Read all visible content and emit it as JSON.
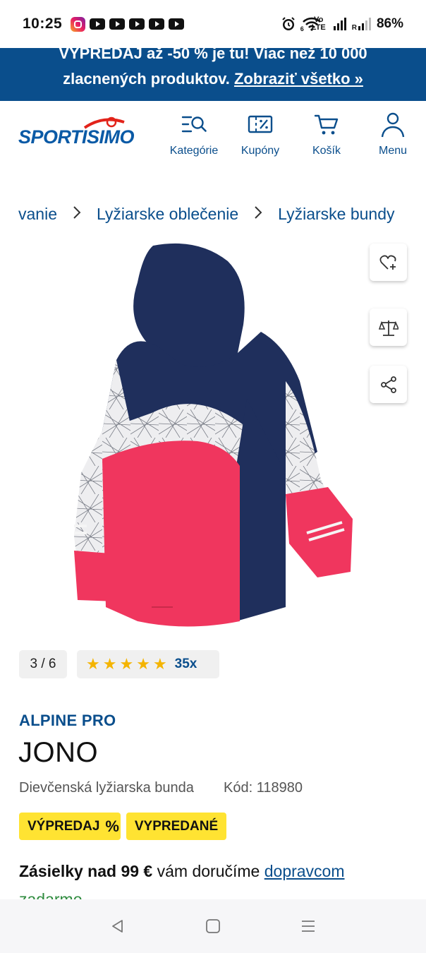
{
  "status": {
    "time": "10:25",
    "battery": "86%",
    "volte": "Vo LTE",
    "net": "6",
    "roaming": "R",
    "apps": [
      "instagram-icon",
      "youtube-icon",
      "youtube-icon",
      "youtube-icon",
      "youtube-icon",
      "youtube-icon"
    ]
  },
  "promo": {
    "line1": "VÝPREDAJ až -50 % je tu! Viac než 10 000",
    "line2_text": "zlacnených produktov.",
    "link": "Zobraziť všetko »"
  },
  "header": {
    "logo": "SPORTISIMO",
    "nav": [
      {
        "label": "Kategórie",
        "icon": "categories-search-icon"
      },
      {
        "label": "Kupóny",
        "icon": "coupon-icon"
      },
      {
        "label": "Košík",
        "icon": "cart-icon"
      },
      {
        "label": "Menu",
        "icon": "user-icon"
      }
    ]
  },
  "breadcrumb": {
    "items": [
      "vanie",
      "Lyžiarske oblečenie",
      "Lyžiarske bundy"
    ]
  },
  "gallery": {
    "counter": "3 / 6",
    "rating_stars": 5,
    "rating_count": "35x",
    "image_alt": "Dievčenská lyžiarska bunda ALPINE PRO JONO - zadný pohľad"
  },
  "product": {
    "brand": "ALPINE PRO",
    "name": "JONO",
    "description": "Dievčenská lyžiarska bunda",
    "code": "Kód: 118980",
    "badges": {
      "sale": "VÝPREDAJ",
      "sale_symbol": "%",
      "sold_out": "VYPREDANÉ"
    },
    "shipping": {
      "bold": "Zásielky nad 99 €",
      "text": " vám doručíme ",
      "link": "dopravcom",
      "link2": "zadarmo"
    }
  },
  "colors": {
    "brand_blue": "#0a4e8c",
    "badge_yellow": "#ffe332",
    "star": "#f4b400"
  }
}
